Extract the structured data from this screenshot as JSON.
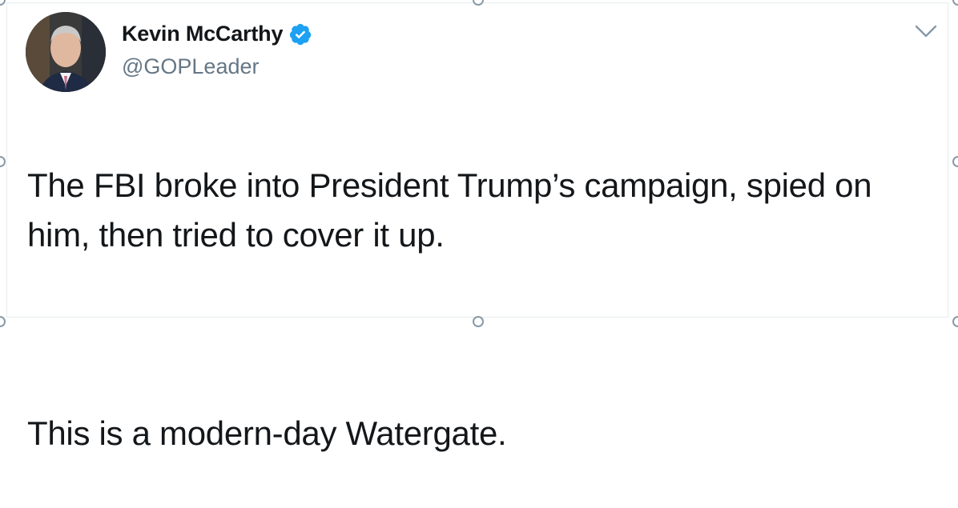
{
  "tweet": {
    "author": {
      "name": "Kevin McCarthy",
      "handle": "@GOPLeader",
      "verified": true,
      "verified_badge_color": "#1da1f2"
    },
    "text_paragraphs": [
      "The FBI broke into President Trump’s campaign, spied on him, then tried to cover it up.",
      "This is a modern-day Watergate."
    ],
    "menu_icon": "chevron-down-icon"
  },
  "colors": {
    "text_primary": "#14171a",
    "text_secondary": "#657786",
    "border": "#e6ecf0"
  }
}
